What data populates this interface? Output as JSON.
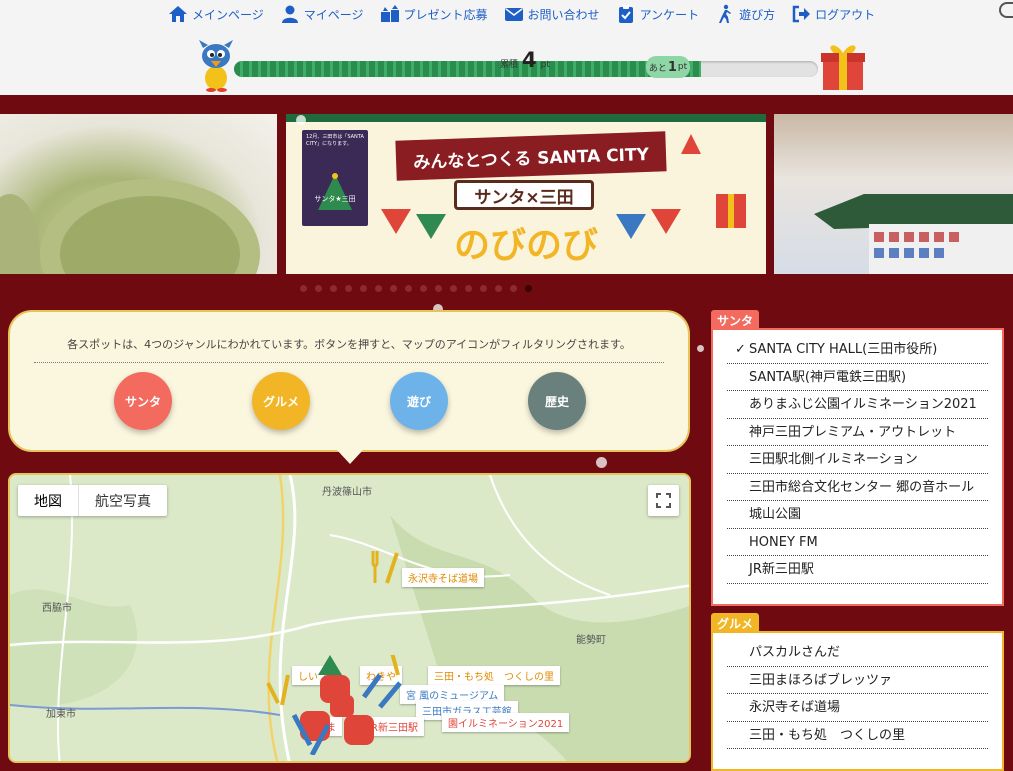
{
  "nav": {
    "items": [
      {
        "label": "メインページ",
        "icon": "home-icon"
      },
      {
        "label": "マイページ",
        "icon": "user-icon"
      },
      {
        "label": "プレゼント応募",
        "icon": "gifts-icon"
      },
      {
        "label": "お問い合わせ",
        "icon": "envelope-icon"
      },
      {
        "label": "アンケート",
        "icon": "clipboard-check-icon"
      },
      {
        "label": "遊び方",
        "icon": "walking-icon"
      },
      {
        "label": "ログアウト",
        "icon": "sign-out-icon"
      }
    ]
  },
  "points": {
    "prefix": "累積",
    "current": "4",
    "unit": "pt",
    "remain_prefix": "あと",
    "remain": "1",
    "remain_unit": "pt",
    "progress_fraction": 0.8
  },
  "slider": {
    "banner_small_text": "12月、三田市は「SANTA CITY」になります。",
    "banner_badge": "サンタ★三田",
    "banner_title": "みんなとつくる SANTA CITY",
    "banner_subtitle": "サンタ×三田",
    "banner_big": "のびのび",
    "dot_count": 16,
    "active_dot": 15
  },
  "info": {
    "text": "各スポットは、4つのジャンルにわかれています。ボタンを押すと、マップのアイコンがフィルタリングされます。",
    "genres": [
      {
        "label": "サンタ",
        "color": "#f26b5e"
      },
      {
        "label": "グルメ",
        "color": "#f2b526"
      },
      {
        "label": "遊び",
        "color": "#6db3ea"
      },
      {
        "label": "歴史",
        "color": "#6a807c"
      }
    ]
  },
  "map": {
    "type_buttons": [
      "地図",
      "航空写真"
    ],
    "places": [
      "丹波篠山市",
      "西脇市",
      "加東市",
      "能勢町"
    ],
    "spot_labels": [
      "永沢寺そば道場",
      "三田・もち処　つくしの里",
      "しい",
      "わきや",
      "宮 風のミュージアム",
      "三田市ガラス工芸館",
      "田ま",
      "R新三田駅",
      "園イルミネーション2021"
    ]
  },
  "side": {
    "santa": {
      "title": "サンタ",
      "color": "#f26b5e",
      "items": [
        "SANTA CITY HALL(三田市役所)",
        "SANTA駅(神戸電鉄三田駅)",
        "ありまふじ公園イルミネーション2021",
        "神戸三田プレミアム・アウトレット",
        "三田駅北側イルミネーション",
        "三田市総合文化センター 郷の音ホール",
        "城山公園",
        "HONEY FM",
        "JR新三田駅"
      ],
      "checked_mark": "✓"
    },
    "gourmet": {
      "title": "グルメ",
      "color": "#f2b526",
      "items": [
        "パスカルさんだ",
        "三田まほろばブレッツァ",
        "永沢寺そば道場",
        "三田・もち処　つくしの里"
      ]
    }
  }
}
